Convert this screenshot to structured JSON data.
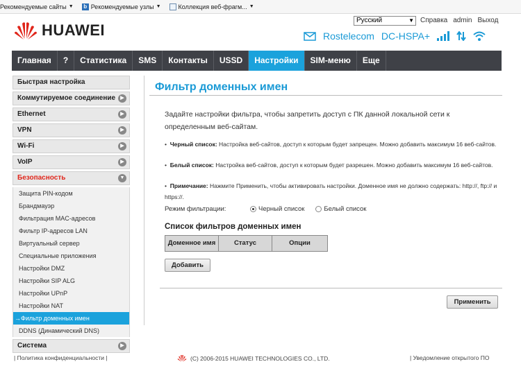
{
  "favorites": [
    "Рекомендуемые сайты",
    "Рекомендуемые узлы",
    "Коллекция веб-фрагм..."
  ],
  "brand": "HUAWEI",
  "language": "Русский",
  "top_links": [
    "Справка",
    "admin",
    "Выход"
  ],
  "status": {
    "operator": "Rostelecom",
    "network": "DC-HSPA+"
  },
  "nav": [
    "Главная",
    "?",
    "Статистика",
    "SMS",
    "Контакты",
    "USSD",
    "Настройки",
    "SIM-меню",
    "Еще"
  ],
  "nav_active": "Настройки",
  "sidebar": {
    "top": [
      "Быстрая настройка",
      "Коммутируемое соединение",
      "Ethernet",
      "VPN",
      "Wi-Fi",
      "VoIP"
    ],
    "open_section": "Безопасность",
    "sub": [
      "Защита PIN-кодом",
      "Брандмауэр",
      "Фильтрация MAC-адресов",
      "Фильтр IP-адресов LAN",
      "Виртуальный сервер",
      "Специальные приложения",
      "Настройки DMZ",
      "Настройки SIP ALG",
      "Настройки UPnP",
      "Настройки NAT",
      "Фильтр доменных имен",
      "DDNS (Динамический DNS)"
    ],
    "active_sub": "Фильтр доменных имен",
    "bottom": [
      "Система"
    ]
  },
  "page": {
    "title": "Фильтр доменных имен",
    "intro": "Задайте настройки фильтра, чтобы запретить доступ с ПК данной локальной сети к определенным веб-сайтам.",
    "bullets": [
      {
        "term": "Черный список:",
        "text": " Настройка веб-сайтов, доступ к которым будет запрещен. Можно добавить максимум 16 веб-сайтов."
      },
      {
        "term": "Белый список:",
        "text": " Настройка веб-сайтов, доступ к которым будет разрешен. Можно добавить максимум 16 веб-сайтов."
      },
      {
        "term": "Примечание:",
        "text": " Нажмите Применить, чтобы активировать настройки. Доменное имя не должно содержать: http://, ftp:// и https://."
      }
    ],
    "mode_label": "Режим фильтрации:",
    "mode_options": [
      "Черный список",
      "Белый список"
    ],
    "mode_selected": "Черный список",
    "list_title": "Список фильтров доменных имен",
    "columns": [
      "Доменное имя",
      "Статус",
      "Опции"
    ],
    "add_button": "Добавить",
    "apply_button": "Применить"
  },
  "footer": {
    "privacy": "Политика конфиденциальности",
    "copyright": "(C) 2006-2015 HUAWEI TECHNOLOGIES CO., LTD.",
    "notice": "Уведомление открытого ПО"
  }
}
